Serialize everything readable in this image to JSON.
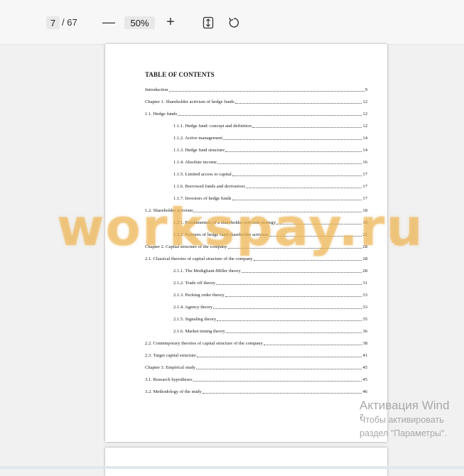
{
  "toolbar": {
    "current_page": "7",
    "total_pages": "/ 67",
    "zoom_out_glyph": "—",
    "zoom_level": "50%",
    "zoom_in_glyph": "+",
    "fit_icon": "fit-page-icon",
    "rotate_icon": "rotate-icon"
  },
  "document": {
    "title": "TABLE OF CONTENTS",
    "entries": [
      {
        "label": "Introduction",
        "page": "9",
        "level": 0
      },
      {
        "label": "Chapter 1. Shareholder activism of hedge funds",
        "page": "12",
        "level": 0
      },
      {
        "label": "1.1. Hedge funds",
        "page": "12",
        "level": 0
      },
      {
        "label": "1.1.1. Hedge fund: concept and definition",
        "page": "12",
        "level": 2
      },
      {
        "label": "1.1.2. Active management",
        "page": "14",
        "level": 2
      },
      {
        "label": "1.1.3. Hedge fund structure",
        "page": "14",
        "level": 2
      },
      {
        "label": "1.1.4. Absolute income",
        "page": "16",
        "level": 2
      },
      {
        "label": "1.1.5. Limited access to capital",
        "page": "17",
        "level": 2
      },
      {
        "label": "1.1.6. Borrowed funds and derivatives",
        "page": "17",
        "level": 2
      },
      {
        "label": "1.1.7. Investors of hedge funds",
        "page": "17",
        "level": 2
      },
      {
        "label": "1.2. Shareholder activism",
        "page": "18",
        "level": 0
      },
      {
        "label": "1.2.1. Fundamentals of a shareholder activism strategy",
        "page": "18",
        "level": 2
      },
      {
        "label": "1.2.2. Features of hedge fund shareholder activism",
        "page": "21",
        "level": 2
      },
      {
        "label": "Chapter 2. Capital structure of the company",
        "page": "28",
        "level": 0
      },
      {
        "label": "2.1. Classical theories of capital structure of the company",
        "page": "28",
        "level": 0
      },
      {
        "label": "2.1.1. The Modigliani-Miller theory",
        "page": "28",
        "level": 2
      },
      {
        "label": "2.1.2. Trade off theory",
        "page": "31",
        "level": 2
      },
      {
        "label": "2.1.3. Pecking order theory",
        "page": "33",
        "level": 2
      },
      {
        "label": "2.1.4. Agency theory",
        "page": "33",
        "level": 2
      },
      {
        "label": "2.1.5. Signaling theory",
        "page": "35",
        "level": 2
      },
      {
        "label": "2.1.6. Market timing theory",
        "page": "36",
        "level": 2
      },
      {
        "label": "2.2. Contemporary theories of capital structure of the company",
        "page": "38",
        "level": 0
      },
      {
        "label": "2.3. Target capital structure",
        "page": "41",
        "level": 0
      },
      {
        "label": "Chapter 3. Empirical study",
        "page": "45",
        "level": 0
      },
      {
        "label": "3.1. Research hypotheses",
        "page": "45",
        "level": 0
      },
      {
        "label": "3.2. Methodology of the study",
        "page": "46",
        "level": 0
      }
    ],
    "page_number": "7"
  },
  "watermark": "workspay.ru",
  "activation": {
    "title": "Активация Wind",
    "line1": "Чтобы активировать",
    "line2": "раздел \"Параметры\"."
  }
}
